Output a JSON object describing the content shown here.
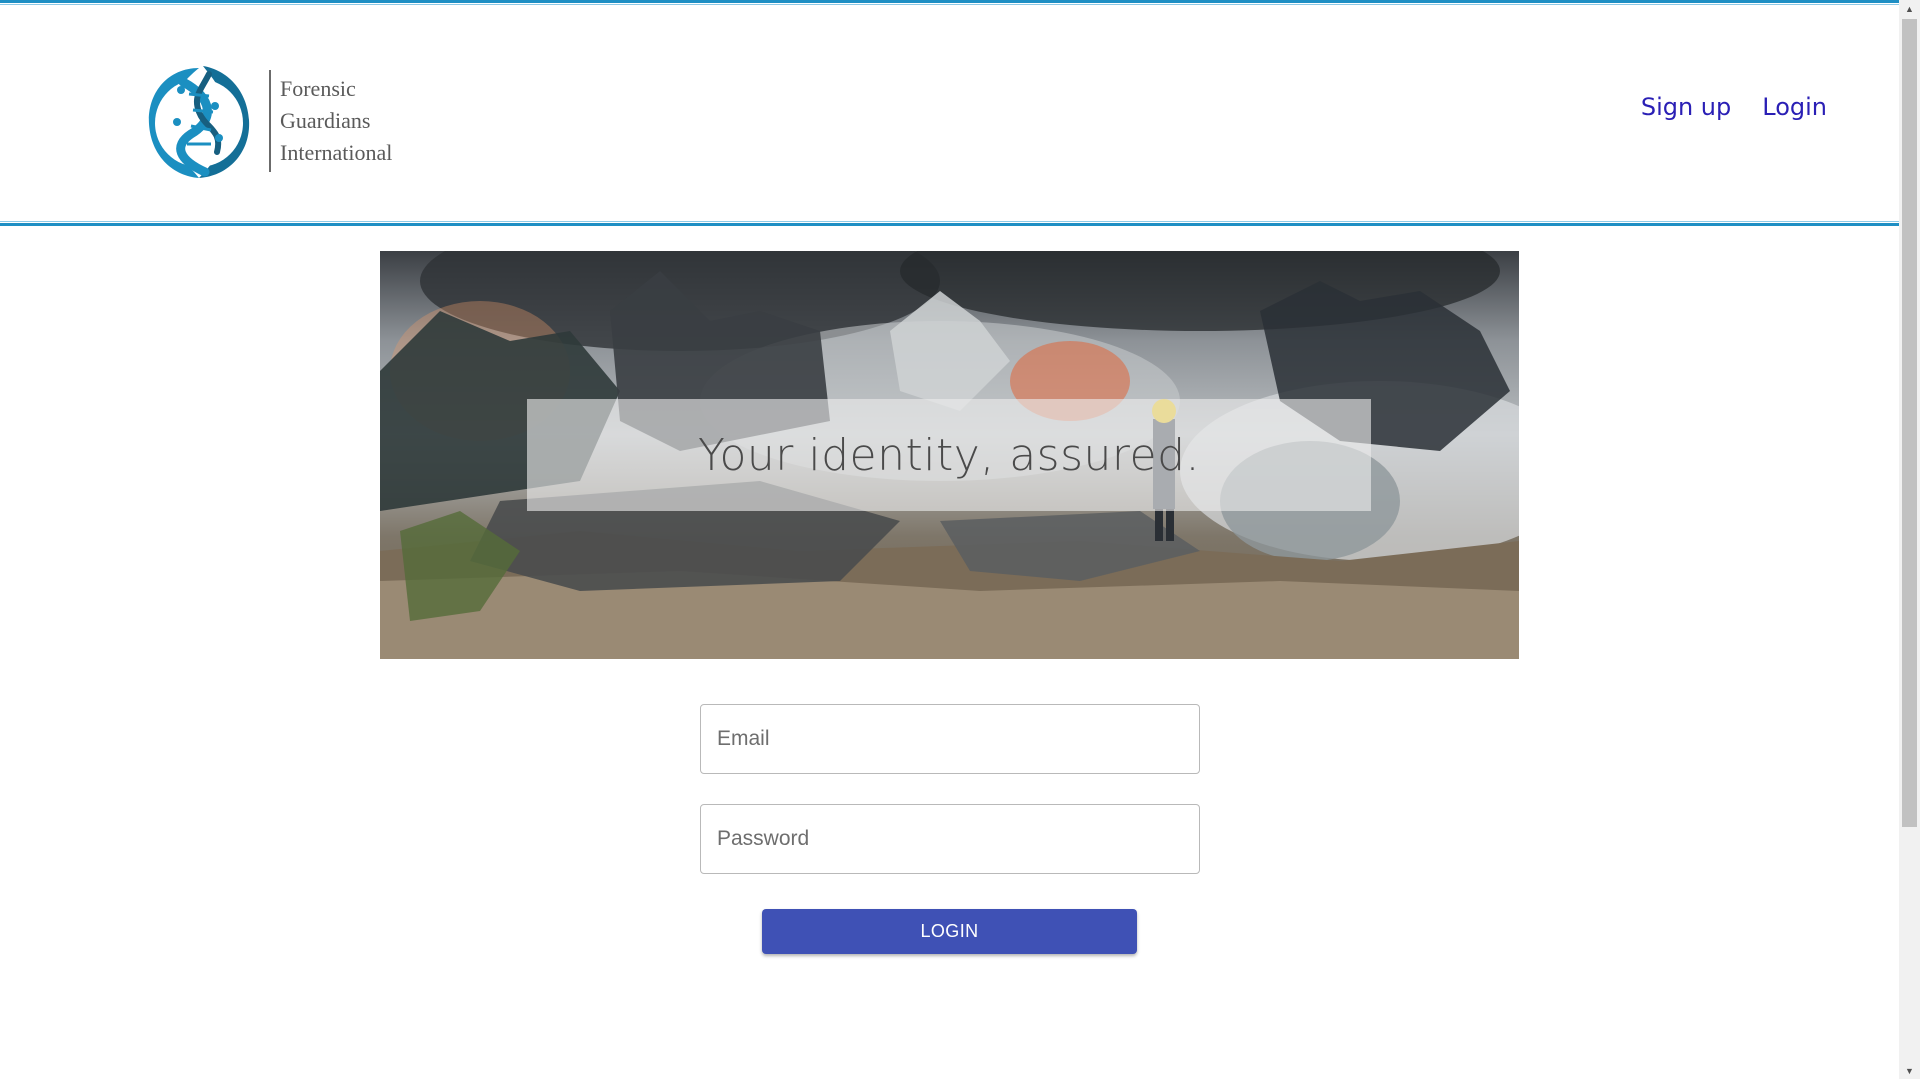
{
  "brand": {
    "line1": "Forensic",
    "line2": "Guardians",
    "line3": "International"
  },
  "nav": {
    "signup_label": "Sign up",
    "login_label": "Login"
  },
  "hero": {
    "tagline": "Your identity, assured."
  },
  "form": {
    "email_placeholder": "Email",
    "password_placeholder": "Password",
    "login_button": "LOGIN"
  },
  "colors": {
    "accent": "#1f8fc4",
    "nav_link": "#2a1fb5",
    "button": "#3f51b5"
  }
}
